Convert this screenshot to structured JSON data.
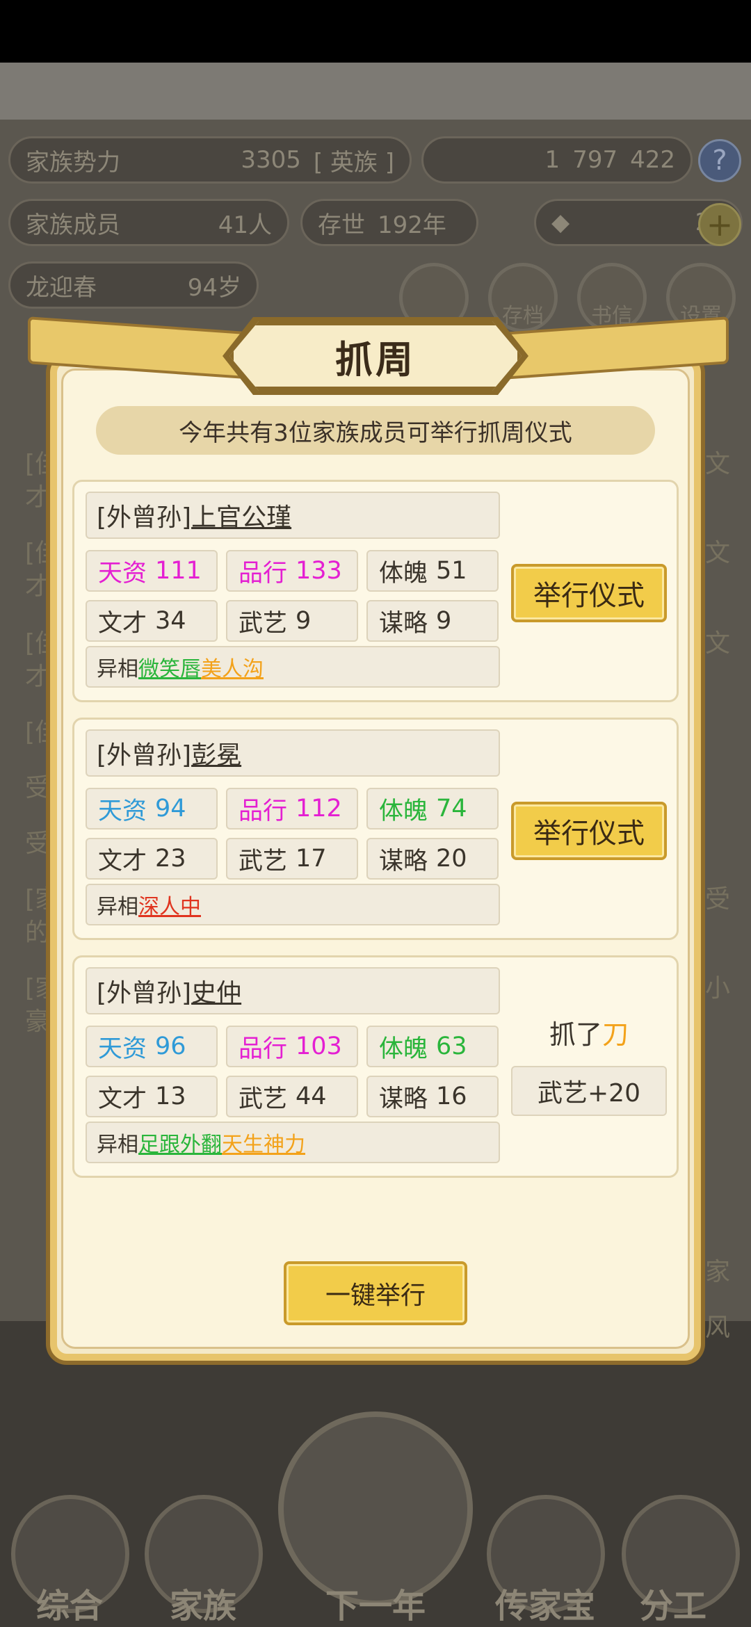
{
  "header": {
    "family_power_label": "家族势力",
    "family_power_value": "3305",
    "family_rank": "[ 英族 ]",
    "silver": "1",
    "gold_ingots": "797",
    "silver_ingots": "422",
    "members_label": "家族成员",
    "members_value": "41人",
    "existence_label": "存世",
    "existence_value": "192年",
    "ingot_count": "23",
    "patriarch_name": "龙迎春",
    "patriarch_age": "94岁"
  },
  "modal": {
    "title": "抓周",
    "banner": "今年共有3位家族成员可举行抓周仪式",
    "one_click_label": "一键举行",
    "cards": [
      {
        "relation": "[外曾孙]",
        "name": "上官公瑾",
        "stats": [
          {
            "label": "天资",
            "value": "111",
            "color": "#e41fd2"
          },
          {
            "label": "品行",
            "value": "133",
            "color": "#e41fd2"
          },
          {
            "label": "体魄",
            "value": "51",
            "color": "#3a342b"
          },
          {
            "label": "文才",
            "value": "34",
            "color": "#3a342b"
          },
          {
            "label": "武艺",
            "value": "9",
            "color": "#3a342b"
          },
          {
            "label": "谋略",
            "value": "9",
            "color": "#3a342b"
          }
        ],
        "trait_label": "异相",
        "traits": [
          {
            "text": "微笑唇",
            "color": "#2ab53b"
          },
          {
            "text": "美人沟",
            "color": "#f3a21a"
          }
        ],
        "action_label": "举行仪式"
      },
      {
        "relation": "[外曾孙]",
        "name": "彭冕",
        "stats": [
          {
            "label": "天资",
            "value": "94",
            "color": "#2f9ad7"
          },
          {
            "label": "品行",
            "value": "112",
            "color": "#e41fd2"
          },
          {
            "label": "体魄",
            "value": "74",
            "color": "#2ab53b"
          },
          {
            "label": "文才",
            "value": "23",
            "color": "#3a342b"
          },
          {
            "label": "武艺",
            "value": "17",
            "color": "#3a342b"
          },
          {
            "label": "谋略",
            "value": "20",
            "color": "#3a342b"
          }
        ],
        "trait_label": "异相",
        "traits": [
          {
            "text": "深人中",
            "color": "#e0341f"
          }
        ],
        "action_label": "举行仪式"
      },
      {
        "relation": "[外曾孙]",
        "name": "史仲",
        "stats": [
          {
            "label": "天资",
            "value": "96",
            "color": "#2f9ad7"
          },
          {
            "label": "品行",
            "value": "103",
            "color": "#e41fd2"
          },
          {
            "label": "体魄",
            "value": "63",
            "color": "#2ab53b"
          },
          {
            "label": "文才",
            "value": "13",
            "color": "#3a342b"
          },
          {
            "label": "武艺",
            "value": "44",
            "color": "#3a342b"
          },
          {
            "label": "谋略",
            "value": "16",
            "color": "#3a342b"
          }
        ],
        "trait_label": "异相",
        "traits": [
          {
            "text": "足跟外翻",
            "color": "#2ab53b"
          },
          {
            "text": "天生神力",
            "color": "#f3a21a"
          }
        ],
        "result_prefix": "抓了",
        "result_item": "刀",
        "result_effect": "武艺+20"
      }
    ]
  },
  "background": {
    "round_buttons": [
      "存档",
      "书信",
      "设置"
    ],
    "log_fragments": [
      "[佳",
      "才",
      "[佳",
      "才",
      "[佳",
      "才",
      "[佳",
      "受",
      "受",
      "[家",
      "的",
      "[家",
      "豪",
      "文",
      "文",
      "文",
      "受",
      "小",
      "家",
      "风"
    ]
  },
  "bottom_nav": {
    "items": [
      "综合",
      "家族",
      "下一年",
      "传家宝",
      "分工"
    ]
  }
}
